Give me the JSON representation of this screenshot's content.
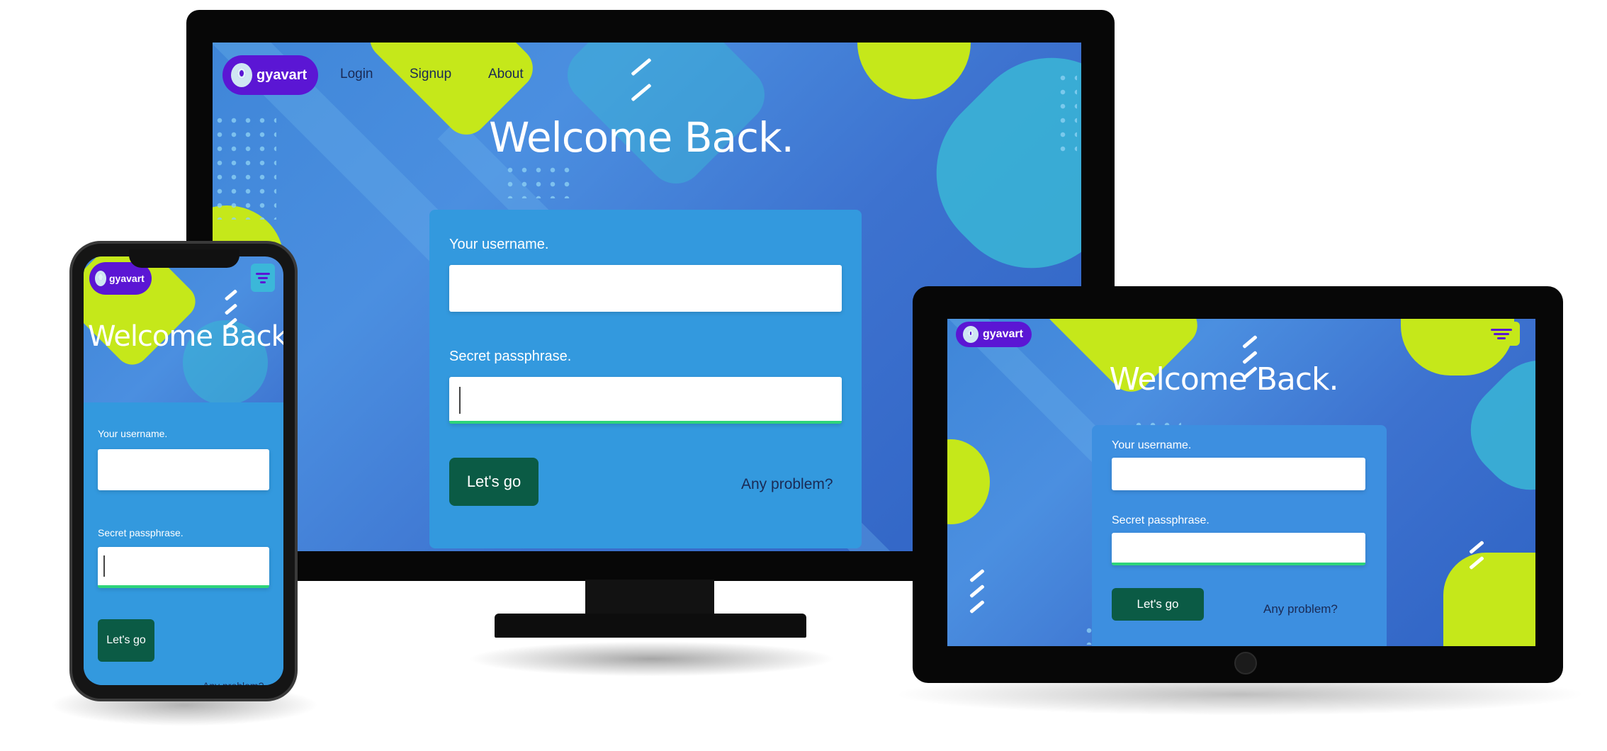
{
  "brand": {
    "name": "gyavart",
    "color": "#5b16d4"
  },
  "nav": {
    "login": "Login",
    "signup": "Signup",
    "about": "About"
  },
  "login": {
    "heading": "Welcome Back.",
    "username_label": "Your username.",
    "username_value": "",
    "password_label": "Secret passphrase.",
    "password_value": "",
    "submit_label": "Let's go",
    "help_link": "Any problem?"
  },
  "theme": {
    "panel": "#3399de",
    "button": "#0b5b45",
    "accent_lime": "#c5e81a",
    "focus_underline": "#2ed47a"
  },
  "icons": {
    "menu": "filter-menu-icon",
    "logo": "astronaut-logo-icon"
  }
}
